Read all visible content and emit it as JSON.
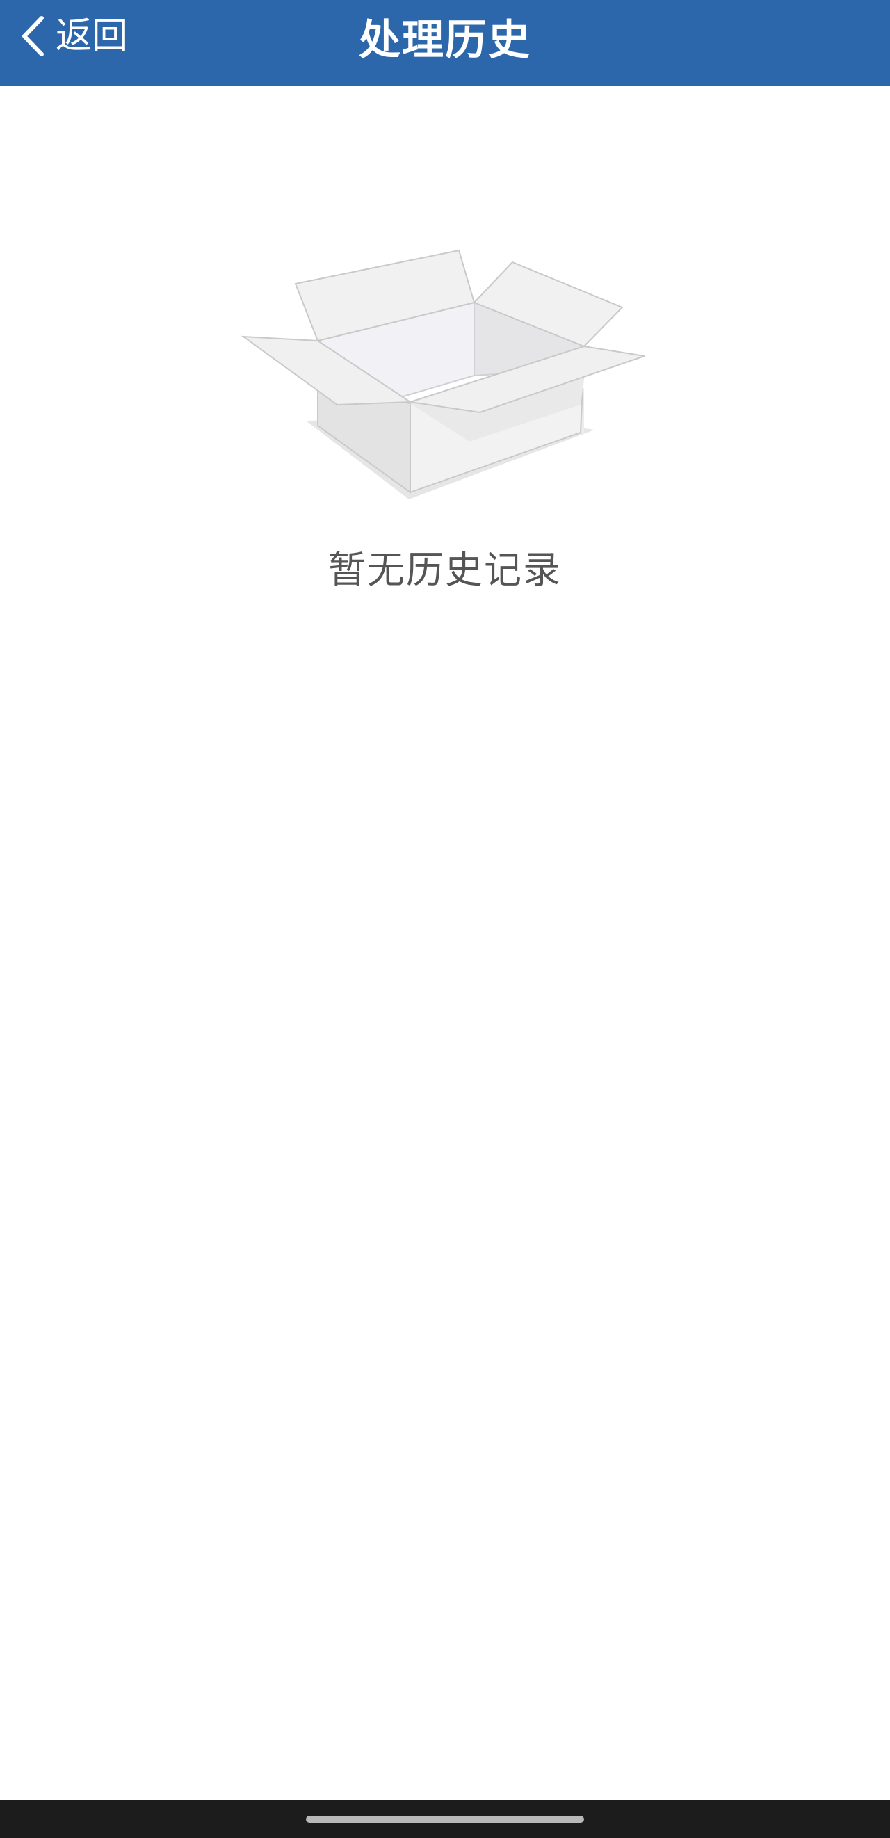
{
  "header": {
    "back_label": "返回",
    "title": "处理历史",
    "back_icon": "chevron-left-icon"
  },
  "empty_state": {
    "icon": "empty-box-icon",
    "message": "暂无历史记录"
  },
  "colors": {
    "header_bg": "#2d67ab",
    "header_text": "#ffffff",
    "empty_text": "#555555",
    "nav_bar_bg": "#1c1c1c"
  }
}
